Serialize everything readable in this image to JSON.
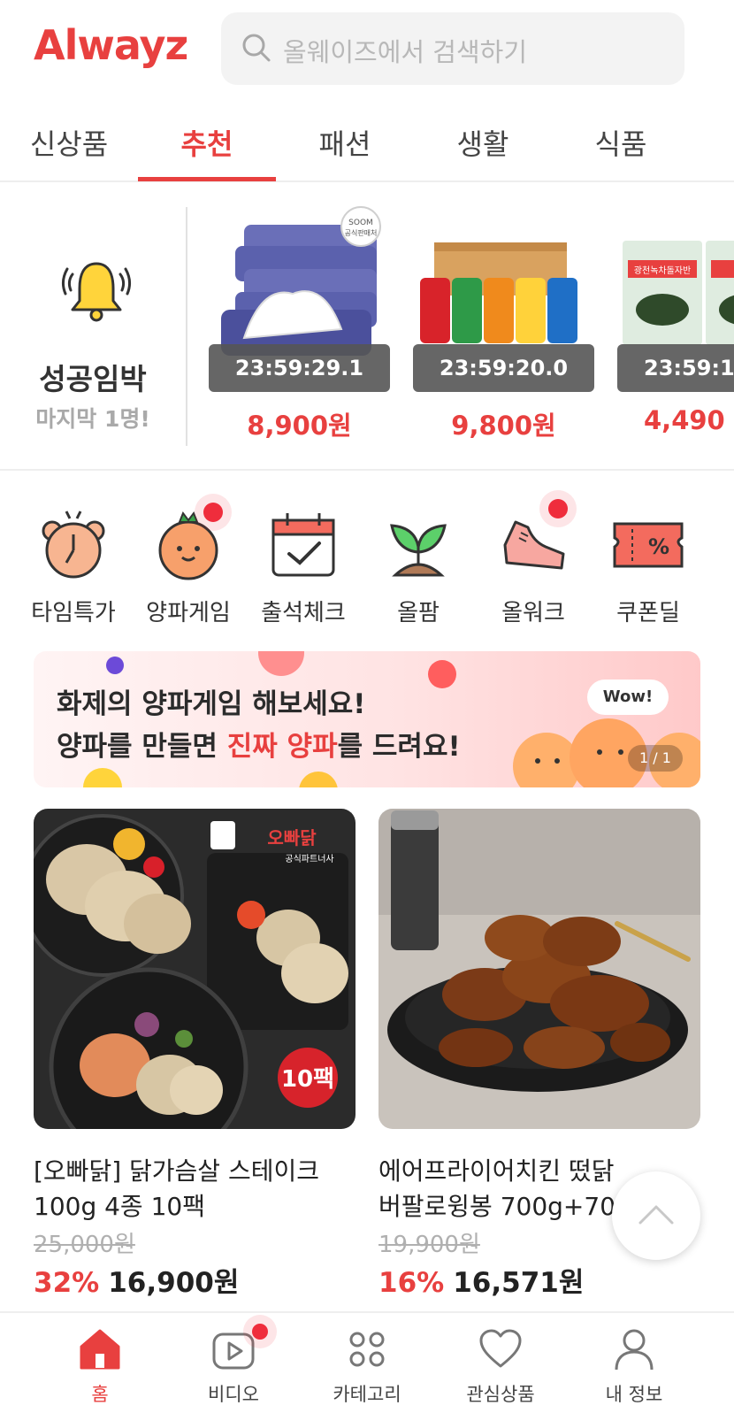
{
  "header": {
    "logo": "Alwayz",
    "search_placeholder": "올웨이즈에서 검색하기"
  },
  "tabs": [
    {
      "label": "신상품",
      "active": false
    },
    {
      "label": "추천",
      "active": true
    },
    {
      "label": "패션",
      "active": false
    },
    {
      "label": "생활",
      "active": false
    },
    {
      "label": "식품",
      "active": false
    }
  ],
  "deal_section": {
    "title": "성공임박",
    "subtitle": "마지막 1명!",
    "items": [
      {
        "timer": "23:59:29.1",
        "price": "8,900원",
        "badge_top": "SOOM",
        "badge_bottom": "공식판매처",
        "image": "wet-wipes-pack"
      },
      {
        "timer": "23:59:20.0",
        "price": "9,800원",
        "image": "assorted-soda-cans"
      },
      {
        "timer": "23:59:1",
        "price": "4,490",
        "image_text": "광천녹차돌자반",
        "image": "seasoned-seaweed-pack"
      }
    ]
  },
  "menu": [
    {
      "label": "타임특가",
      "icon": "alarm-clock-bear-icon",
      "dot": false
    },
    {
      "label": "양파게임",
      "icon": "onion-character-icon",
      "dot": true
    },
    {
      "label": "출석체크",
      "icon": "calendar-check-icon",
      "dot": false
    },
    {
      "label": "올팜",
      "icon": "sprout-icon",
      "dot": false
    },
    {
      "label": "올워크",
      "icon": "sneaker-icon",
      "dot": true
    },
    {
      "label": "쿠폰딜",
      "icon": "coupon-icon",
      "dot": false
    }
  ],
  "banner": {
    "line1": "화제의 양파게임 해보세요!",
    "line2_prefix": "양파를 만들면 ",
    "line2_highlight": "진짜 양파",
    "line2_suffix": "를 드려요!",
    "bubble": "Wow!",
    "pager": "1 / 1"
  },
  "products": [
    {
      "name_line1": "[오빠닭] 닭가슴살 스테이크",
      "name_line2": "100g 4종 10팩",
      "original_price": "25,000원",
      "discount": "32%",
      "price": "16,900원",
      "image": "chicken-breast-steak",
      "image_badge": "10팩",
      "brand_text": "오빠닭",
      "brand_sub": "공식파트너사"
    },
    {
      "name_line1": "에어프라이어치킨 떴닭",
      "name_line2": "버팔로윙봉 700g+700g",
      "original_price": "19,900원",
      "discount": "16%",
      "price": "16,571원",
      "image": "buffalo-wings"
    }
  ],
  "bottom_nav": [
    {
      "label": "홈",
      "icon": "home-icon",
      "active": true
    },
    {
      "label": "비디오",
      "icon": "video-play-icon",
      "active": false
    },
    {
      "label": "카테고리",
      "icon": "category-grid-icon",
      "active": false
    },
    {
      "label": "관심상품",
      "icon": "heart-icon",
      "active": false
    },
    {
      "label": "내 정보",
      "icon": "person-icon",
      "active": false
    }
  ],
  "colors": {
    "accent": "#e8403f",
    "timer_bg": "#555555",
    "badge_dot": "#ef2d3c"
  }
}
